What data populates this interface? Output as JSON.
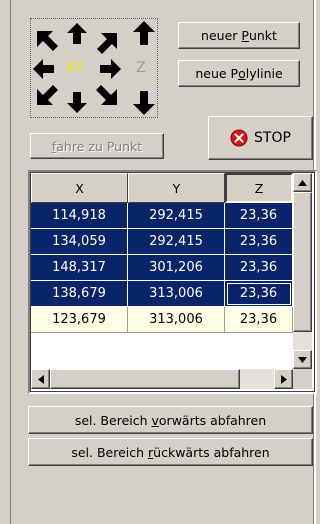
{
  "pad": {
    "center_label": "XY",
    "z_label": "Z"
  },
  "buttons": {
    "new_point_prefix": "neuer ",
    "new_point_ul": "P",
    "new_point_suffix": "unkt",
    "new_polyline_prefix": "neue P",
    "new_polyline_ul": "o",
    "new_polyline_suffix": "lylinie",
    "goto_point_ul": "f",
    "goto_point_suffix": "ahre zu Punkt",
    "stop_label": "STOP",
    "forward_prefix": "sel. Bereich ",
    "forward_ul": "v",
    "forward_suffix": "orwärts abfahren",
    "backward_prefix": "sel. Bereich ",
    "backward_ul": "r",
    "backward_suffix": "ückwärts abfahren"
  },
  "table": {
    "columns": [
      "X",
      "Y",
      "Z"
    ],
    "rows": [
      [
        "114,918",
        "292,415",
        "23,36"
      ],
      [
        "134,059",
        "292,415",
        "23,36"
      ],
      [
        "148,317",
        "301,206",
        "23,36"
      ],
      [
        "138,679",
        "313,006",
        "23,36"
      ],
      [
        "123,679",
        "313,006",
        "23,36"
      ]
    ]
  },
  "colors": {
    "selection": "#0a246a",
    "current_row": "#ffffe6",
    "stop_icon": "#e01010",
    "xy_label": "#e8e800"
  }
}
